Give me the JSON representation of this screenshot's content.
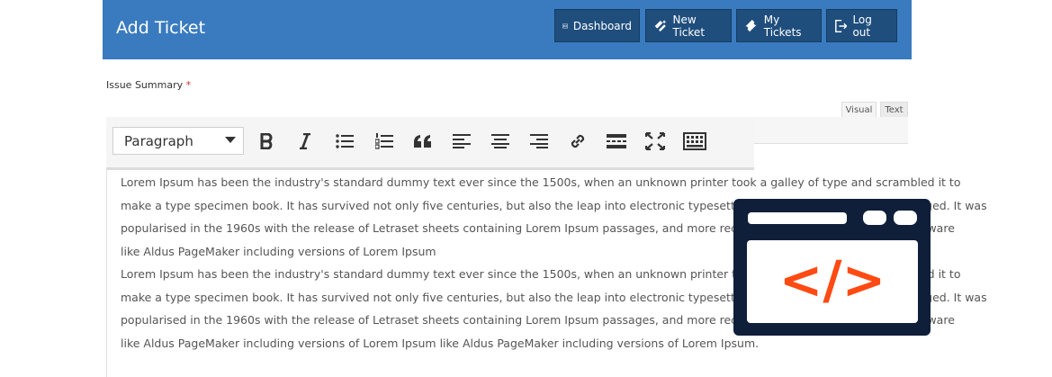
{
  "header": {
    "title": "Add Ticket",
    "buttons": [
      {
        "label": "Dashboard",
        "icon": "dashboard-icon"
      },
      {
        "label": "New Ticket",
        "icon": "new-ticket-icon"
      },
      {
        "label": "My Tickets",
        "icon": "ticket-icon"
      },
      {
        "label": "Log out",
        "icon": "logout-icon"
      }
    ]
  },
  "form": {
    "issue_label": "Issue Summary",
    "required_mark": "*"
  },
  "editor": {
    "tabs": [
      "Visual",
      "Text"
    ],
    "format_select": "Paragraph",
    "toolbar_icons": [
      "bold-icon",
      "italic-icon",
      "bullet-list-icon",
      "numbered-list-icon",
      "blockquote-icon",
      "align-left-icon",
      "align-center-icon",
      "align-right-icon",
      "link-icon",
      "read-more-icon",
      "fullscreen-icon",
      "toolbar-toggle-icon"
    ],
    "content_lines": [
      "Lorem Ipsum has been the industry's standard dummy text ever since the 1500s, when an unknown printer took a galley of type and scrambled it to",
      "make a type specimen book. It has survived not only five centuries, but also the leap into electronic typesetting, remaining essentially unchanged. It was",
      "popularised in the 1960s with the release of Letraset sheets containing Lorem Ipsum passages, and more recently with desktop publishing software",
      "like Aldus PageMaker including versions of Lorem Ipsum",
      "Lorem Ipsum has been the industry's standard dummy text ever since the 1500s, when an unknown printer took a galley of type and scrambled it to",
      "make a type specimen book. It has survived not only five centuries, but also the leap into electronic typesetting, remaining essentially unchanged. It was",
      "popularised in the 1960s with the release of Letraset sheets containing Lorem Ipsum passages, and more recently with desktop publishing software",
      "like Aldus PageMaker including versions of Lorem Ipsum like Aldus PageMaker including versions of Lorem Ipsum."
    ]
  },
  "widget": {
    "icon": "code-window-icon",
    "code_text": "</>",
    "colors": {
      "frame": "#0f1f3a",
      "code": "#ff4a12"
    }
  },
  "colors": {
    "header_bg": "#3a7bbf",
    "button_bg": "#1f4e7d"
  }
}
